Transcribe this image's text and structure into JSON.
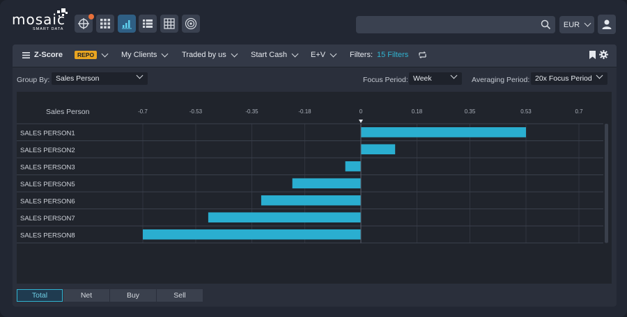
{
  "brand": {
    "name": "mosaic",
    "subtitle": "SMART DATA"
  },
  "nav": {
    "buttons": [
      {
        "icon": "network-icon",
        "active": false
      },
      {
        "icon": "grid-icon",
        "active": false
      },
      {
        "icon": "bar-chart-icon",
        "active": true
      },
      {
        "icon": "list-icon",
        "active": false
      },
      {
        "icon": "table-icon",
        "active": false
      },
      {
        "icon": "target-icon",
        "active": false
      }
    ]
  },
  "search": {
    "value": "",
    "placeholder": ""
  },
  "currency": {
    "value": "EUR"
  },
  "filterbar": {
    "mode": "Z-Score",
    "badge": "REPO",
    "clients": "My Clients",
    "traded": "Traded by us",
    "start": "Start Cash",
    "ev": "E+V",
    "filters_label": "Filters:",
    "filters_count": "15 Filters"
  },
  "controls": {
    "group_by_label": "Group By:",
    "group_by_value": "Sales Person",
    "focus_label": "Focus Period:",
    "focus_value": "Week",
    "averaging_label": "Averaging Period:",
    "averaging_value": "20x Focus Period"
  },
  "chart_data": {
    "type": "bar",
    "orientation": "horizontal",
    "ylabel": "Sales Person",
    "categories": [
      "SALES PERSON1",
      "SALES PERSON2",
      "SALES PERSON3",
      "SALES PERSON5",
      "SALES PERSON6",
      "SALES PERSON7",
      "SALES PERSON8"
    ],
    "values": [
      0.53,
      0.11,
      -0.05,
      -0.22,
      -0.32,
      -0.49,
      -0.7
    ],
    "xticks": [
      -0.7,
      -0.53,
      -0.35,
      -0.18,
      0,
      0.18,
      0.35,
      0.53,
      0.7
    ],
    "xtick_labels": [
      "-0.7",
      "-0.53",
      "-0.35",
      "-0.18",
      "0",
      "0.18",
      "0.35",
      "0.53",
      "0.7"
    ],
    "xlim": [
      -0.75,
      0.78
    ],
    "bar_color": "#2aaed0",
    "grid": true
  },
  "tabs": [
    {
      "label": "Total",
      "active": true
    },
    {
      "label": "Net",
      "active": false
    },
    {
      "label": "Buy",
      "active": false
    },
    {
      "label": "Sell",
      "active": false
    }
  ]
}
